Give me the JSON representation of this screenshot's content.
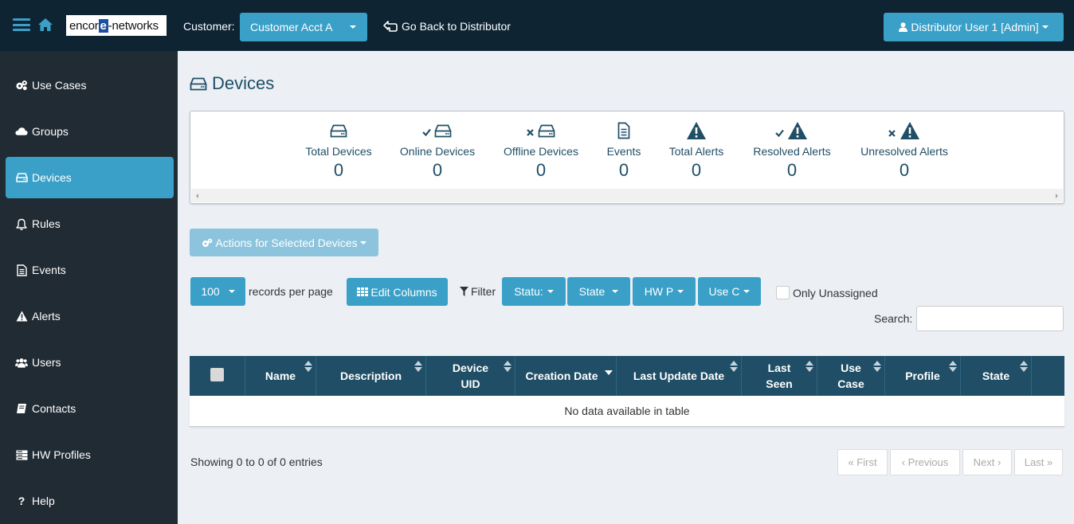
{
  "header": {
    "logo_text": "encore networks",
    "customer_label": "Customer:",
    "customer_value": "Customer Acct A",
    "go_back": "Go Back to Distributor",
    "user_menu": "Distributor User 1 [Admin]"
  },
  "sidebar": {
    "items": [
      {
        "label": "Use Cases",
        "icon": "cogs-icon"
      },
      {
        "label": "Groups",
        "icon": "cloud-icon"
      },
      {
        "label": "Devices",
        "icon": "hdd-icon",
        "active": true
      },
      {
        "label": "Rules",
        "icon": "bell-icon"
      },
      {
        "label": "Events",
        "icon": "file-icon"
      },
      {
        "label": "Alerts",
        "icon": "warning-icon"
      },
      {
        "label": "Users",
        "icon": "users-icon"
      },
      {
        "label": "Contacts",
        "icon": "book-icon"
      },
      {
        "label": "HW Profiles",
        "icon": "server-icon"
      },
      {
        "label": "Help",
        "icon": "question-icon"
      }
    ]
  },
  "page": {
    "title": "Devices"
  },
  "stats": [
    {
      "label": "Total Devices",
      "value": "0",
      "icon": "hdd-icon"
    },
    {
      "label": "Online Devices",
      "value": "0",
      "icon": "check-hdd-icon"
    },
    {
      "label": "Offline Devices",
      "value": "0",
      "icon": "x-hdd-icon"
    },
    {
      "label": "Events",
      "value": "0",
      "icon": "file-icon"
    },
    {
      "label": "Total Alerts",
      "value": "0",
      "icon": "warning-icon"
    },
    {
      "label": "Resolved Alerts",
      "value": "0",
      "icon": "check-warning-icon"
    },
    {
      "label": "Unresolved Alerts",
      "value": "0",
      "icon": "x-warning-icon"
    }
  ],
  "toolbar": {
    "actions": "Actions for Selected Devices",
    "records_value": "100",
    "records_label": "records per page",
    "edit_columns": "Edit Columns",
    "filter_label": "Filter",
    "filters": [
      "Statu:",
      "State",
      "HW P",
      "Use C"
    ],
    "only_unassigned": "Only Unassigned",
    "search_label": "Search:"
  },
  "table": {
    "columns": [
      "Name",
      "Description",
      "Device UID",
      "Creation Date",
      "Last Update Date",
      "Last Seen",
      "Use Case",
      "Profile",
      "State"
    ],
    "empty_message": "No data available in table",
    "info": "Showing 0 to 0 of 0 entries"
  },
  "pagination": {
    "first": "« First",
    "previous": "‹ Previous",
    "next": "Next ›",
    "last": "Last »"
  },
  "colors": {
    "accent": "#3aa0c8",
    "header_bg": "#0e2433",
    "sidebar_bg": "#212b33",
    "table_header": "#1f4e66",
    "content_bg": "#ecf0f5"
  }
}
